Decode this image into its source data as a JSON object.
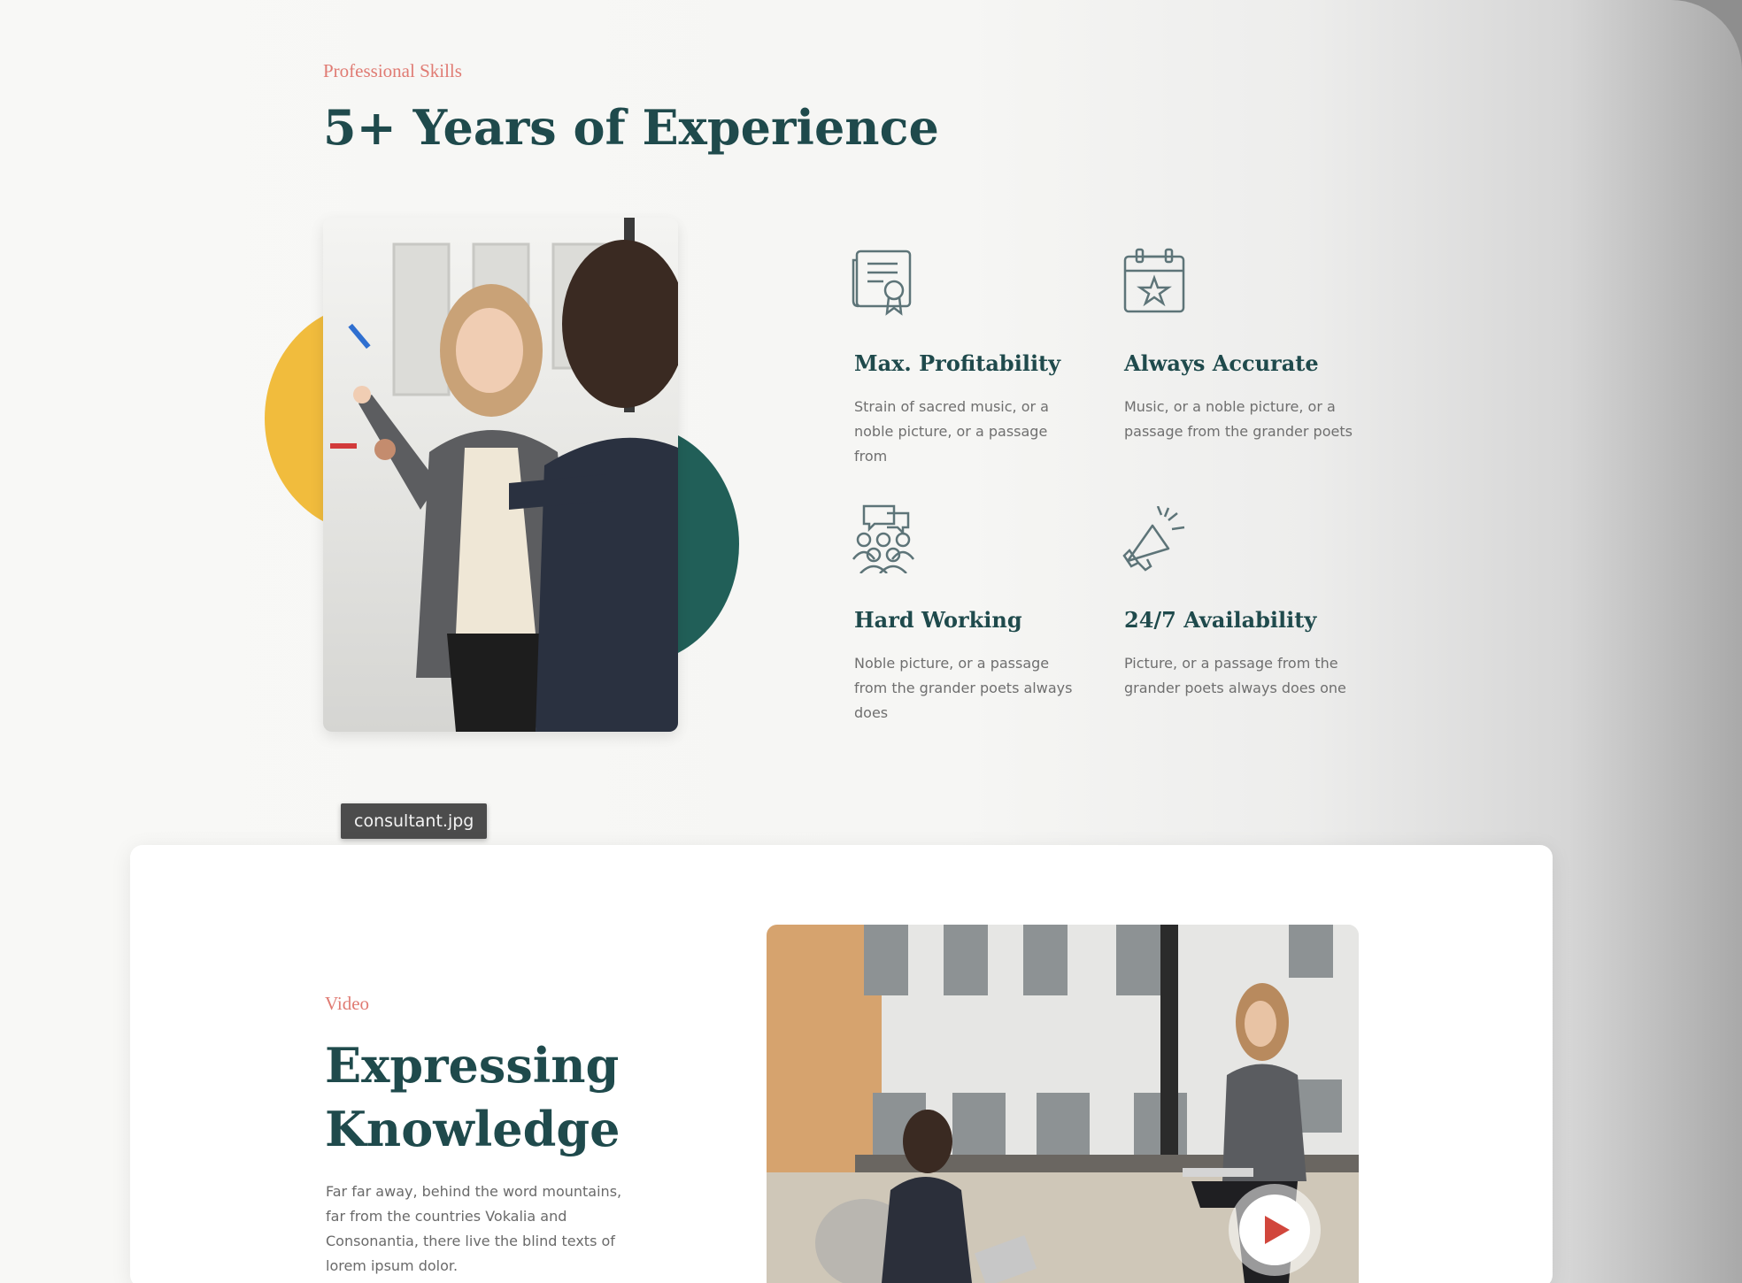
{
  "skills": {
    "eyebrow": "Professional Skills",
    "title": "5+ Years of Experience"
  },
  "features": [
    {
      "title": "Max. Profitability",
      "desc": "Strain of sacred music, or a noble picture, or a passage from",
      "icon": "certificate-icon"
    },
    {
      "title": "Always Accurate",
      "desc": "Music, or a noble picture, or a passage from the grander poets",
      "icon": "calendar-star-icon"
    },
    {
      "title": "Hard Working",
      "desc": "Noble picture, or a passage from the grander poets always does",
      "icon": "team-chat-icon"
    },
    {
      "title": "24/7 Availability",
      "desc": "Picture, or a passage from the grander poets always does one",
      "icon": "megaphone-icon"
    }
  ],
  "tooltip": "consultant.jpg",
  "video": {
    "eyebrow": "Video",
    "title_line1": "Expressing",
    "title_line2": "Knowledge",
    "desc": "Far far away, behind the word mountains, far from the countries Vokalia and Consonantia, there live the blind texts of lorem ipsum dolor."
  },
  "colors": {
    "accent_coral": "#e07b73",
    "heading_teal": "#1f4a4c",
    "yellow": "#f1bc3d",
    "teal": "#215f58",
    "play_red": "#d1463c"
  }
}
